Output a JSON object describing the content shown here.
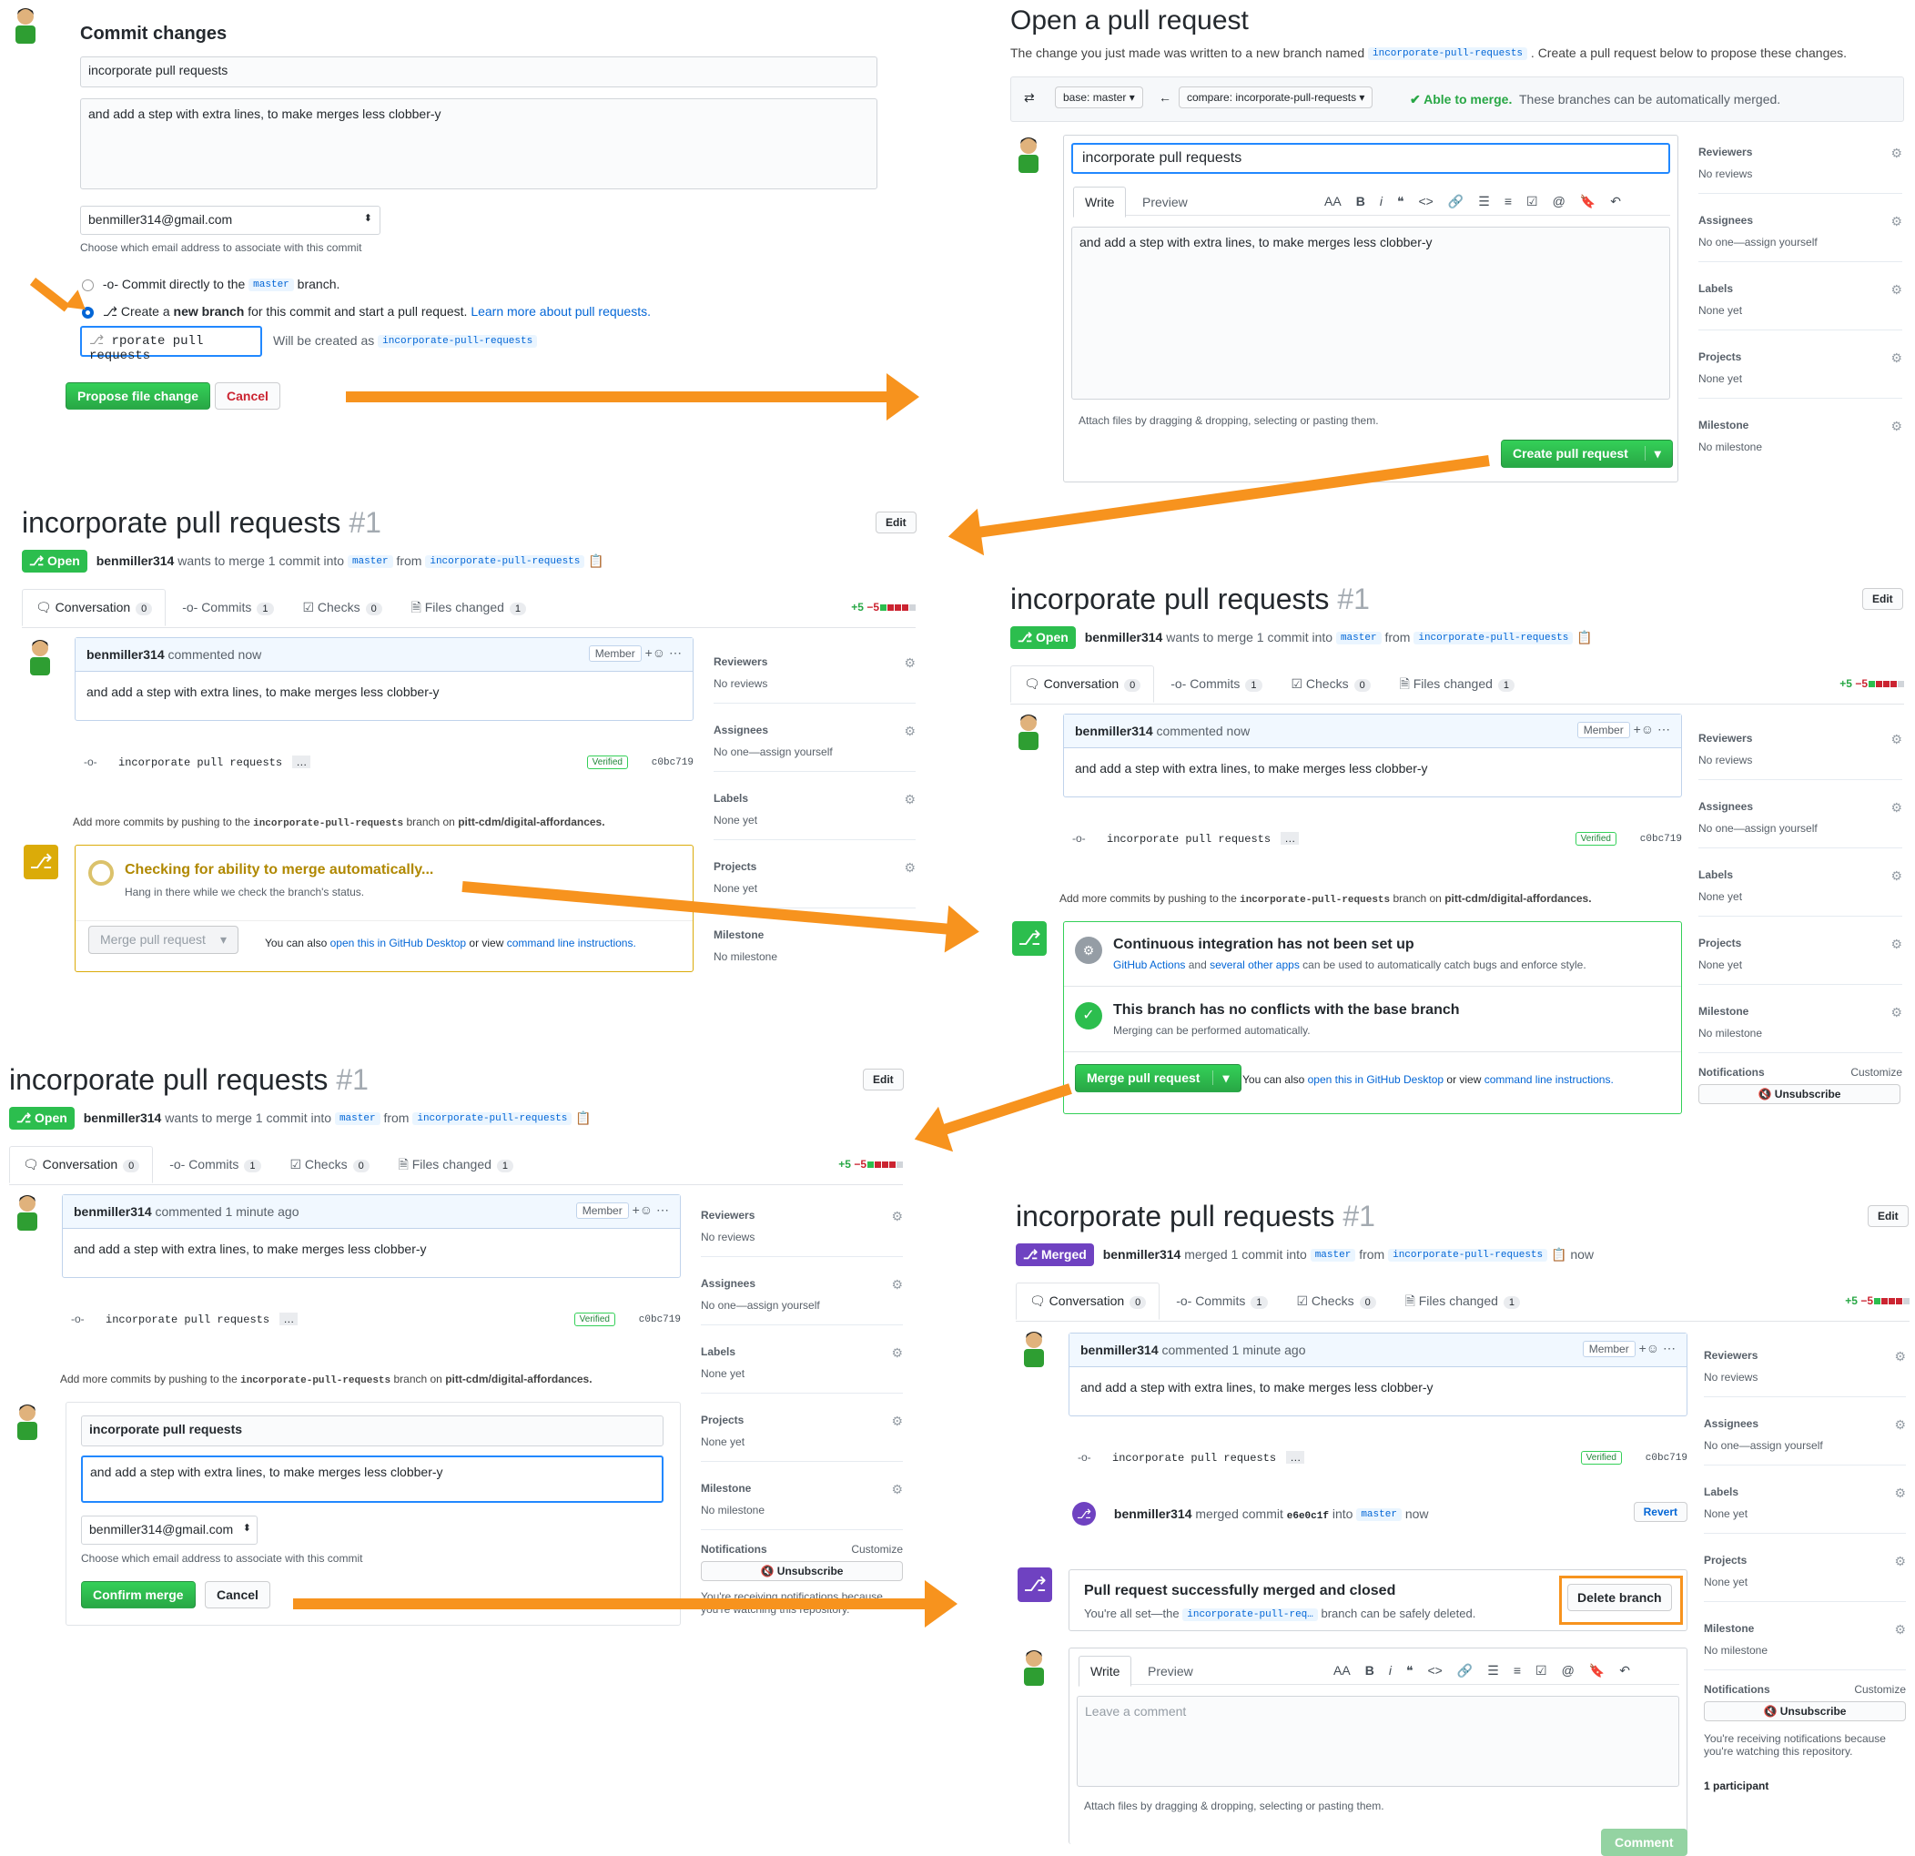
{
  "commit_panel": {
    "title": "Commit changes",
    "summary_value": "incorporate pull requests",
    "description_value": "and add a step with extra lines, to make merges less clobber-y",
    "email_value": "benmiller314@gmail.com",
    "email_hint": "Choose which email address to associate with this commit",
    "radio_direct_prefix": "Commit directly to the",
    "radio_direct_branch": "master",
    "radio_direct_suffix": "branch.",
    "radio_new_prefix": "Create a",
    "radio_new_bold": "new branch",
    "radio_new_suffix": "for this commit and start a pull request.",
    "radio_new_link": "Learn more about pull requests.",
    "branch_input_value": "rporate pull requests",
    "will_be_created": "Will be created as",
    "will_be_created_branch": "incorporate-pull-requests",
    "propose_button": "Propose file change",
    "cancel_button": "Cancel"
  },
  "open_pr": {
    "title": "Open a pull request",
    "subtitle_prefix": "The change you just made was written to a new branch named",
    "subtitle_branch": "incorporate-pull-requests",
    "subtitle_suffix": ". Create a pull request below to propose these changes.",
    "base": "base: master ▾",
    "compare": "compare: incorporate-pull-requests ▾",
    "able": "✔ Able to merge.",
    "able_rest": "These branches can be automatically merged.",
    "title_value": "incorporate pull requests",
    "tab_write": "Write",
    "tab_preview": "Preview",
    "body_value": "and add a step with extra lines, to make merges less clobber-y",
    "attach": "Attach files by dragging & dropping, selecting or pasting them.",
    "create_button": "Create pull request",
    "toolbar": [
      "AA",
      "B",
      "i",
      "❝",
      "<>",
      "🔗",
      "☰",
      "≡",
      "☑",
      "@",
      "🔖",
      "↶"
    ]
  },
  "sidebar": {
    "reviewers": "Reviewers",
    "reviewers_val": "No reviews",
    "assignees": "Assignees",
    "assignees_val": "No one—assign yourself",
    "labels": "Labels",
    "labels_val": "None yet",
    "projects": "Projects",
    "projects_val": "None yet",
    "milestone": "Milestone",
    "milestone_val": "No milestone",
    "notifications": "Notifications",
    "customize": "Customize",
    "unsubscribe": "🔇 Unsubscribe",
    "notif_text": "You're receiving notifications because you're watching this repository.",
    "participants": "1 participant"
  },
  "pr": {
    "title": "incorporate pull requests",
    "number": "#1",
    "edit": "Edit",
    "open_badge": "⎇ Open",
    "merged_badge": "⎇ Merged",
    "author": "benmiller314",
    "wants": "wants to merge 1 commit into",
    "merged_text": "merged 1 commit into",
    "base": "master",
    "from": "from",
    "head": "incorporate-pull-requests",
    "now": "now",
    "tab_conversation": "Conversation",
    "tab_commits": "Commits",
    "tab_checks": "Checks",
    "tab_files": "Files changed",
    "count_conv": "0",
    "count_commits": "1",
    "count_checks": "0",
    "count_files": "1",
    "diff_add": "+5",
    "diff_del": "−5",
    "commented_now": "commented now",
    "commented_1m": "commented 1 minute ago",
    "member": "Member",
    "body": "and add a step with extra lines, to make merges less clobber-y",
    "commit_msg": "incorporate pull requests",
    "verified": "Verified",
    "sha": "c0bc719",
    "push_hint_prefix": "Add more commits by pushing to the",
    "push_branch": "incorporate-pull-requests",
    "push_hint_mid": "branch on",
    "push_repo": "pitt-cdm/digital-affordances.",
    "checking_title": "Checking for ability to merge automatically...",
    "checking_sub": "Hang in there while we check the branch's status.",
    "merge_button": "Merge pull request",
    "also_prefix": "You can also",
    "open_desktop": "open this in GitHub Desktop",
    "or_view": "or view",
    "cmd_line": "command line instructions.",
    "ci_title": "Continuous integration has not been set up",
    "ci_link1": "GitHub Actions",
    "ci_and": "and",
    "ci_link2": "several other apps",
    "ci_rest": "can be used to automatically catch bugs and enforce style.",
    "noconf_title": "This branch has no conflicts with the base branch",
    "noconf_sub": "Merging can be performed automatically.",
    "confirm_title_value": "incorporate pull requests",
    "confirm_body_value": "and add a step with extra lines, to make merges less clobber-y",
    "confirm_email": "benmiller314@gmail.com",
    "confirm_email_hint": "Choose which email address to associate with this commit",
    "confirm_button": "Confirm merge",
    "cancel_button": "Cancel",
    "merged_commit": "merged commit",
    "merged_sha": "e6e0c1f",
    "into": "into",
    "revert": "Revert",
    "closed_title": "Pull request successfully merged and closed",
    "closed_sub_prefix": "You're all set—the",
    "closed_branch": "incorporate-pull-req…",
    "closed_sub_suffix": "branch can be safely deleted.",
    "delete_branch": "Delete branch",
    "leave_comment": "Leave a comment",
    "attach": "Attach files by dragging & dropping, selecting or pasting them.",
    "comment_button": "Comment"
  },
  "colors": {
    "arrow": "#f7931e",
    "green": "#2cbe4e",
    "purple": "#6f42c1",
    "blue": "#0366d6"
  }
}
